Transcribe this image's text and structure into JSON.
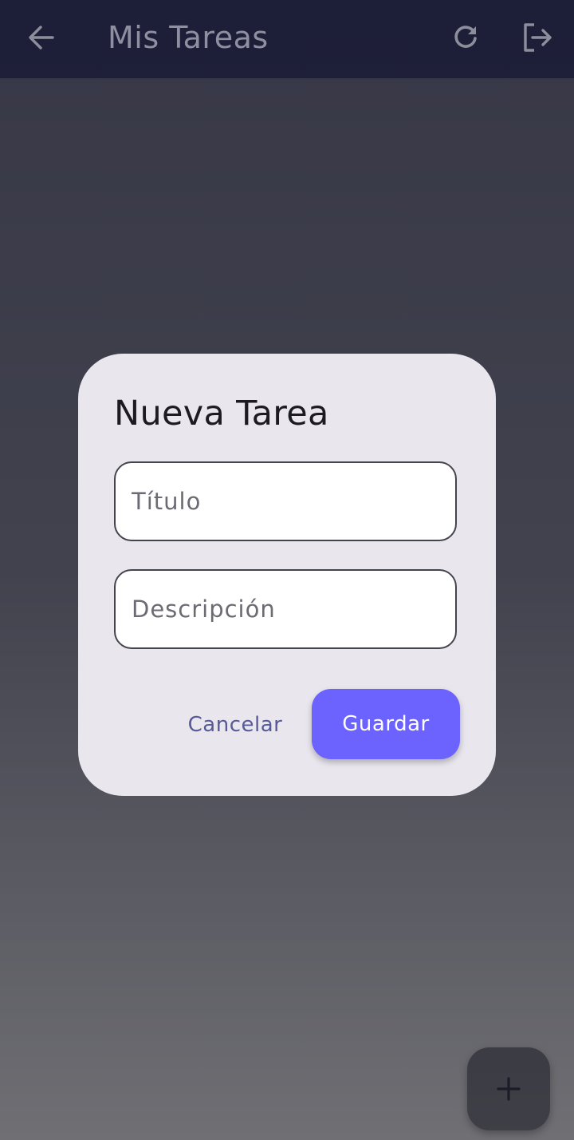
{
  "app_bar": {
    "title": "Mis Tareas",
    "back_icon": "arrow-left-icon",
    "refresh_icon": "refresh-icon",
    "logout_icon": "logout-icon"
  },
  "dialog": {
    "title": "Nueva Tarea",
    "title_field": {
      "placeholder": "Título",
      "value": ""
    },
    "description_field": {
      "placeholder": "Descripción",
      "value": ""
    },
    "cancel_label": "Cancelar",
    "save_label": "Guardar"
  },
  "fab": {
    "icon": "plus-icon"
  },
  "colors": {
    "app_bar": "#4f55a0",
    "dialog_bg": "#e9e6ee",
    "primary_button": "#6c63ff",
    "cancel_text": "#565a98",
    "field_border": "#45434c"
  }
}
